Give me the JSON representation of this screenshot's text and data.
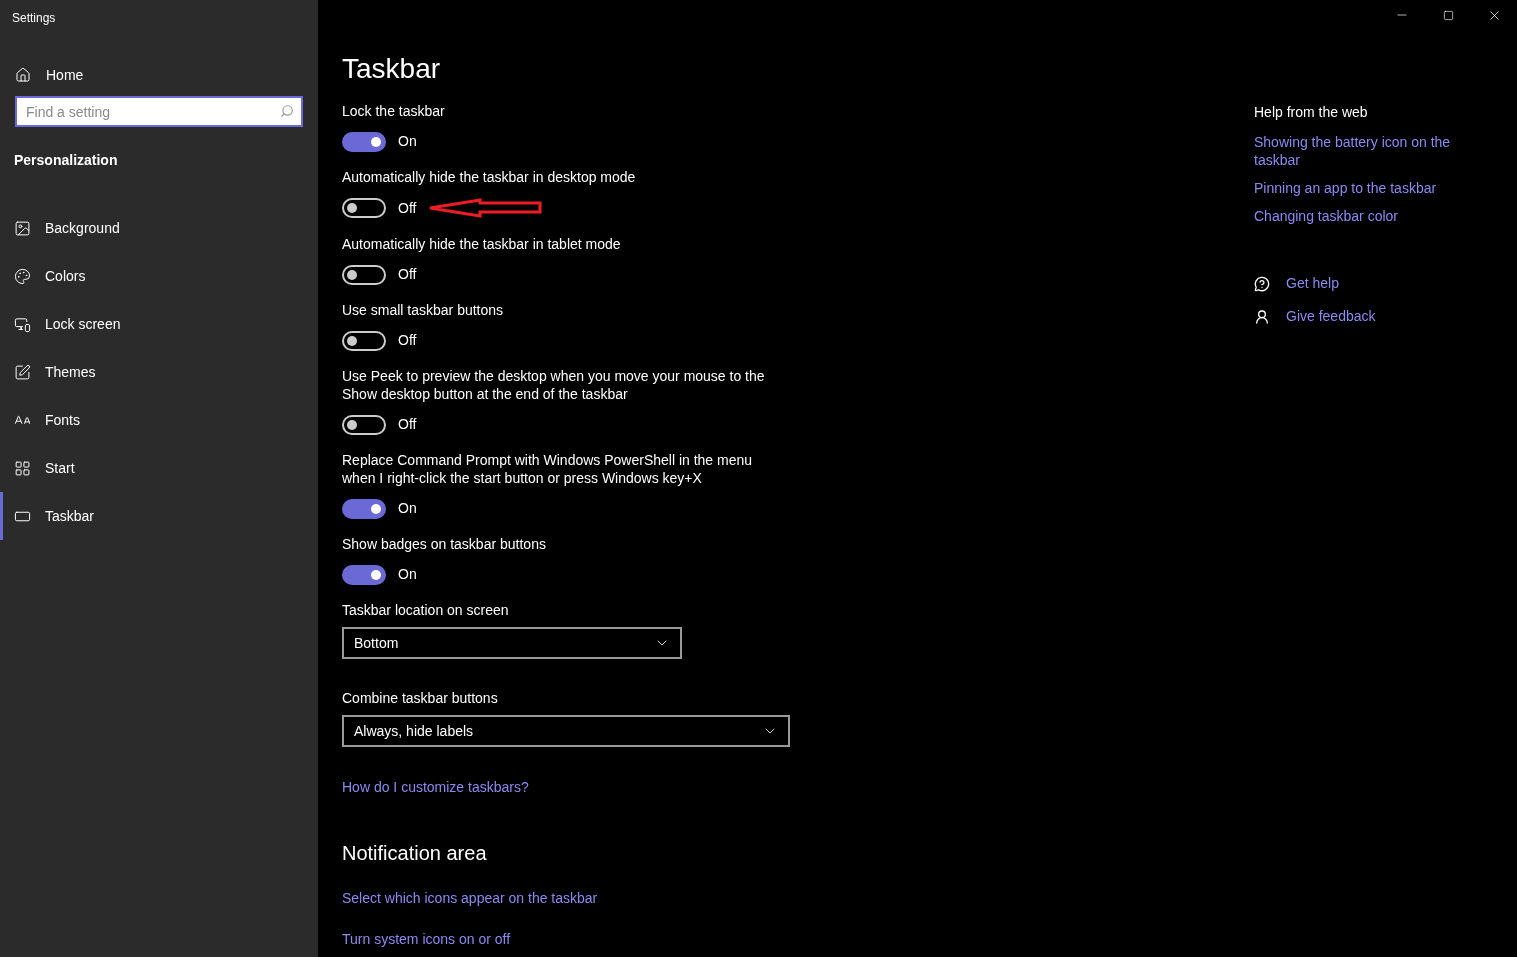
{
  "window": {
    "title": "Settings"
  },
  "sidebar": {
    "home": "Home",
    "search": {
      "placeholder": "Find a setting"
    },
    "section": "Personalization",
    "items": [
      {
        "label": "Background",
        "selected": false
      },
      {
        "label": "Colors",
        "selected": false
      },
      {
        "label": "Lock screen",
        "selected": false
      },
      {
        "label": "Themes",
        "selected": false
      },
      {
        "label": "Fonts",
        "selected": false
      },
      {
        "label": "Start",
        "selected": false
      },
      {
        "label": "Taskbar",
        "selected": true
      }
    ]
  },
  "page": {
    "title": "Taskbar",
    "settings": [
      {
        "kind": "toggle",
        "label": "Lock the taskbar",
        "on": true,
        "state": "On"
      },
      {
        "kind": "toggle",
        "label": "Automatically hide the taskbar in desktop mode",
        "on": false,
        "state": "Off",
        "annotated": true
      },
      {
        "kind": "toggle",
        "label": "Automatically hide the taskbar in tablet mode",
        "on": false,
        "state": "Off"
      },
      {
        "kind": "toggle",
        "label": "Use small taskbar buttons",
        "on": false,
        "state": "Off"
      },
      {
        "kind": "toggle",
        "label": "Use Peek to preview the desktop when you move your mouse to the Show desktop button at the end of the taskbar",
        "on": false,
        "state": "Off"
      },
      {
        "kind": "toggle",
        "label": "Replace Command Prompt with Windows PowerShell in the menu when I right-click the start button or press Windows key+X",
        "on": true,
        "state": "On"
      },
      {
        "kind": "toggle",
        "label": "Show badges on taskbar buttons",
        "on": true,
        "state": "On"
      },
      {
        "kind": "dropdown",
        "label": "Taskbar location on screen",
        "value": "Bottom"
      },
      {
        "kind": "dropdown",
        "label": "Combine taskbar buttons",
        "value": "Always, hide labels"
      }
    ],
    "link": "How do I customize taskbars?",
    "notification_area": {
      "title": "Notification area",
      "links": [
        "Select which icons appear on the taskbar",
        "Turn system icons on or off"
      ]
    }
  },
  "help": {
    "title": "Help from the web",
    "links": [
      "Showing the battery icon on the taskbar",
      "Pinning an app to the taskbar",
      "Changing taskbar color"
    ],
    "actions": [
      "Get help",
      "Give feedback"
    ]
  }
}
